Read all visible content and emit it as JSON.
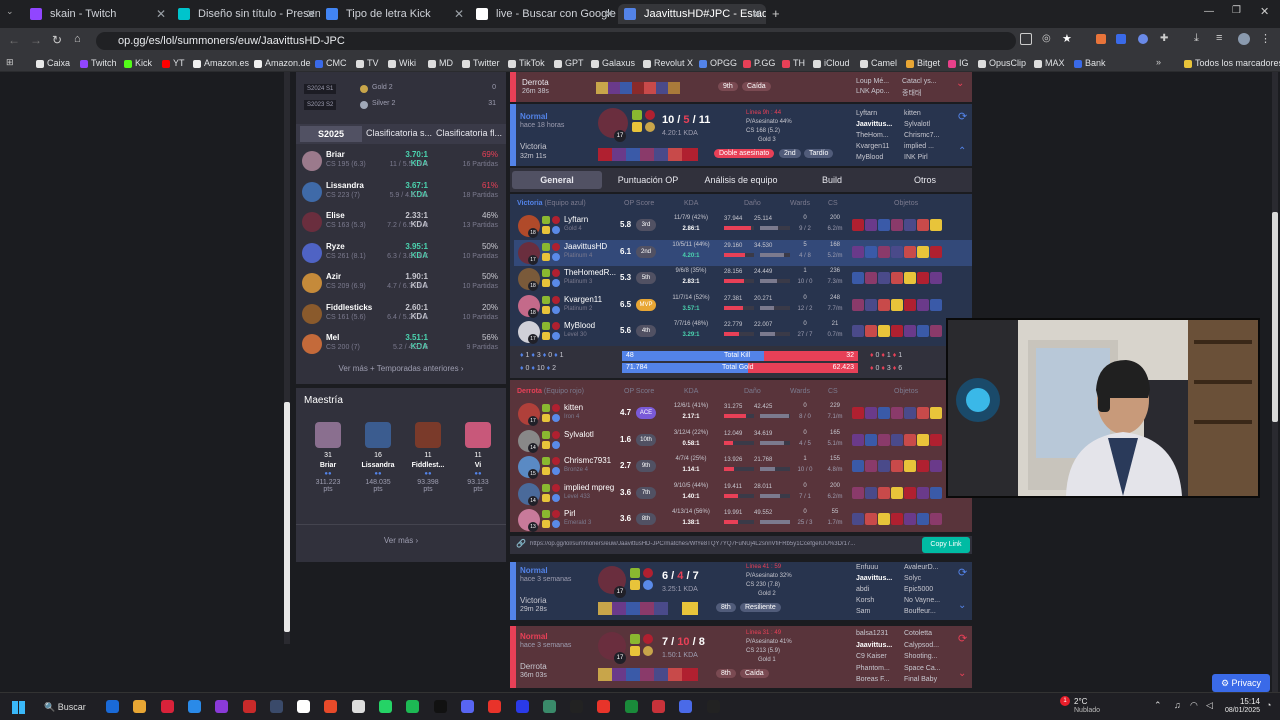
{
  "tabs": [
    {
      "label": "skain - Twitch",
      "color": "#9146ff"
    },
    {
      "label": "Diseño sin título - Presentación",
      "color": "#00c4cc"
    },
    {
      "label": "Tipo de letra Kick",
      "color": "#4285f4"
    },
    {
      "label": "live - Buscar con Google",
      "color": "#ffffff"
    },
    {
      "label": "JaavittusHD#JPC - Estadísticas",
      "color": "#5383e8"
    }
  ],
  "address": "op.gg/es/lol/summoners/euw/JaavittusHD-JPC",
  "bookmarks": [
    "Caixa",
    "Twitch",
    "Kick",
    "YT",
    "Amazon.es",
    "Amazon.de",
    "CMC",
    "TV",
    "Wiki",
    "MD",
    "Twitter",
    "TikTok",
    "GPT",
    "Galaxus",
    "Revolut X",
    "OPGG",
    "P.GG",
    "TH",
    "iCloud",
    "Camel",
    "Bitget",
    "IG",
    "OpusClip",
    "MAX",
    "Bank"
  ],
  "bookmarks_all": "Todos los marcadores",
  "left": {
    "past_seasons": [
      {
        "season": "S2024 S1",
        "rank": "Gold 2",
        "lp": "0"
      },
      {
        "season": "S2023 S2",
        "rank": "Silver 2",
        "lp": "31"
      }
    ],
    "season_tabs": [
      "S2025",
      "Clasificatoria s...",
      "Clasificatoria fl..."
    ],
    "champs": [
      {
        "name": "Briar",
        "cs": "CS 195 (6.3)",
        "kda": "3.70:1 KDA",
        "kda_detail": "11 / 5.5 / 9.4",
        "wr": "69%",
        "games": "16 Partidas",
        "kc": "#4bd5b0",
        "wc": "#e84057",
        "color": "#9b7a8c"
      },
      {
        "name": "Lissandra",
        "cs": "CS 223 (7)",
        "kda": "3.67:1 KDA",
        "kda_detail": "5.9 / 4.6 / 11",
        "wr": "61%",
        "games": "18 Partidas",
        "kc": "#4bd5b0",
        "wc": "#e84057",
        "color": "#3f6aa8"
      },
      {
        "name": "Elise",
        "cs": "CS 163 (5.3)",
        "kda": "2.33:1 KDA",
        "kda_detail": "7.2 / 6.5 / 7.9",
        "wr": "46%",
        "games": "13 Partidas",
        "kc": "#c8c8d0",
        "wc": "#c8c8d0",
        "color": "#6a2e3e"
      },
      {
        "name": "Ryze",
        "cs": "CS 261 (8.1)",
        "kda": "3.95:1 KDA",
        "kda_detail": "6.3 / 3.8 / 8.7",
        "wr": "50%",
        "games": "10 Partidas",
        "kc": "#4bd5b0",
        "wc": "#c8c8d0",
        "color": "#4f63c4"
      },
      {
        "name": "Azir",
        "cs": "CS 209 (6.9)",
        "kda": "1.90:1 KDA",
        "kda_detail": "4.7 / 6.7 / 8.1",
        "wr": "50%",
        "games": "10 Partidas",
        "kc": "#c8c8d0",
        "wc": "#c8c8d0",
        "color": "#c58a3a"
      },
      {
        "name": "Fiddlesticks",
        "cs": "CS 161 (5.6)",
        "kda": "2.60:1 KDA",
        "kda_detail": "6.4 / 5.2 / 7.1",
        "wr": "20%",
        "games": "10 Partidas",
        "kc": "#c8c8d0",
        "wc": "#c8c8d0",
        "color": "#8a5a2c"
      },
      {
        "name": "Mel",
        "cs": "CS 200 (7)",
        "kda": "3.51:1 KDA",
        "kda_detail": "5.2 / 4.3 / 6",
        "wr": "56%",
        "games": "9 Partidas",
        "kc": "#4bd5b0",
        "wc": "#c8c8d0",
        "color": "#c46a3a"
      }
    ],
    "more_seasons": "Ver más + Temporadas anteriores",
    "mastery_title": "Maestría",
    "mastery": [
      {
        "name": "Briar",
        "level": "31",
        "pts": "311.223",
        "unit": "pts",
        "color": "#8a6f8f"
      },
      {
        "name": "Lissandra",
        "level": "16",
        "pts": "148.035",
        "unit": "pts",
        "color": "#3b5c8f"
      },
      {
        "name": "Fiddlest...",
        "level": "11",
        "pts": "93.398",
        "unit": "pts",
        "color": "#7a3a2a"
      },
      {
        "name": "Vi",
        "level": "11",
        "pts": "93.133",
        "unit": "pts",
        "color": "#c8587a"
      }
    ],
    "more": "Ver más"
  },
  "top_match": {
    "result": "Derrota",
    "duration": "26m 38s",
    "tag1": "9th",
    "tag2": "Caída",
    "p1": "Loup Mé...",
    "p2": "LNK Apo...",
    "p3": "Catacl ys...",
    "p4": "종태태"
  },
  "match1": {
    "queue": "Normal",
    "ago": "hace 18 horas",
    "result": "Victoria",
    "duration": "32m 11s",
    "level": "17",
    "k": "10",
    "d": "5",
    "a": "11",
    "kda": "4.20:1 KDA",
    "stats": [
      "Línea 9h : 44",
      "P/Asesinato 44%",
      "CS 168 (5.2)",
      "Gold 3"
    ],
    "badges": [
      "Doble asesinato",
      "2nd",
      "Tardío"
    ],
    "blue_names": [
      "Lyftarn",
      "Jaavittus...",
      "TheHom...",
      "Kvargen11",
      "MyBlood"
    ],
    "red_names": [
      "kitten",
      "Sylvalotl",
      "Chrismc7...",
      "implied ...",
      "INK Pirl"
    ]
  },
  "subtabs": [
    "General",
    "Puntuación OP",
    "Análisis de equipo",
    "Build",
    "Otros"
  ],
  "blue_header": {
    "team": "Victoria",
    "side": "(Equipo azul)",
    "op": "OP Score",
    "kda": "KDA",
    "dmg": "Daño",
    "wards": "Wards",
    "cs": "CS",
    "items": "Objetos"
  },
  "blue": [
    {
      "name": "Lyftarn",
      "rank": "Gold 4",
      "lvl": "18",
      "score": "5.8",
      "pos": "3rd",
      "kda": "11/7/9 (42%)",
      "ratio": "2.86:1",
      "d1": "37.944",
      "d2": "25.114",
      "w": "0",
      "w2": "9 / 2",
      "cs": "200",
      "csm": "6.2/m",
      "f1": 0.9,
      "f2": 0.6,
      "ch": "#b04a2a"
    },
    {
      "name": "JaavittusHD",
      "rank": "Platinum 4",
      "lvl": "17",
      "score": "6.1",
      "pos": "2nd",
      "kda": "10/5/11 (44%)",
      "ratio": "4.20:1",
      "d1": "29.160",
      "d2": "34.530",
      "w": "5",
      "w2": "4 / 8",
      "cs": "168",
      "csm": "5.2/m",
      "f1": 0.7,
      "f2": 0.8,
      "ch": "#6a2e3e",
      "me": true
    },
    {
      "name": "TheHomedR...",
      "rank": "Platinum 3",
      "lvl": "18",
      "score": "5.3",
      "pos": "5th",
      "kda": "9/6/8 (35%)",
      "ratio": "2.83:1",
      "d1": "28.156",
      "d2": "24.449",
      "w": "1",
      "w2": "10 / 0",
      "cs": "236",
      "csm": "7.3/m",
      "f1": 0.65,
      "f2": 0.55,
      "ch": "#7a5a3a"
    },
    {
      "name": "Kvargen11",
      "rank": "Platinum 2",
      "lvl": "18",
      "score": "6.5",
      "pos": "MVP",
      "kda": "11/7/14 (52%)",
      "ratio": "3.57:1",
      "d1": "27.381",
      "d2": "20.271",
      "w": "0",
      "w2": "12 / 2",
      "cs": "248",
      "csm": "7.7/m",
      "f1": 0.62,
      "f2": 0.45,
      "ch": "#c46a8a"
    },
    {
      "name": "MyBlood",
      "rank": "Level 30",
      "lvl": "17",
      "score": "5.6",
      "pos": "4th",
      "kda": "7/7/16 (48%)",
      "ratio": "3.29:1",
      "d1": "22.779",
      "d2": "22.007",
      "w": "0",
      "w2": "27 / 7",
      "cs": "21",
      "csm": "0.7/m",
      "f1": 0.5,
      "f2": 0.5,
      "ch": "#d0d0d8"
    }
  ],
  "totals": {
    "blue_kill": "48",
    "red_kill": "32",
    "kill_label": "Total Kill",
    "blue_gold": "71.784",
    "red_gold": "62.423",
    "gold_label": "Total Gold",
    "blue_obj": [
      "1",
      "3",
      "0",
      "1",
      "0",
      "10",
      "2"
    ],
    "red_obj": [
      "0",
      "1",
      "1",
      "0",
      "3",
      "6"
    ]
  },
  "red_header": {
    "team": "Derrota",
    "side": "(Equipo rojo)"
  },
  "red": [
    {
      "name": "kitten",
      "rank": "Iron 4",
      "lvl": "17",
      "score": "4.7",
      "pos": "ACE",
      "kda": "12/6/1 (41%)",
      "ratio": "2.17:1",
      "d1": "31.275",
      "d2": "42.425",
      "w": "0",
      "w2": "8 / 0",
      "cs": "229",
      "csm": "7.1/m",
      "f1": 0.72,
      "f2": 0.95,
      "ch": "#b0403a"
    },
    {
      "name": "Sylvalotl",
      "rank": "",
      "lvl": "14",
      "score": "1.6",
      "pos": "10th",
      "kda": "3/12/4 (22%)",
      "ratio": "0.58:1",
      "d1": "12.049",
      "d2": "34.619",
      "w": "0",
      "w2": "4 / 5",
      "cs": "165",
      "csm": "5.1/m",
      "f1": 0.3,
      "f2": 0.8,
      "ch": "#888888"
    },
    {
      "name": "Chrismc7931",
      "rank": "Bronze 4",
      "lvl": "15",
      "score": "2.7",
      "pos": "9th",
      "kda": "4/7/4 (25%)",
      "ratio": "1.14:1",
      "d1": "13.926",
      "d2": "21.768",
      "w": "1",
      "w2": "10 / 0",
      "cs": "155",
      "csm": "4.8/m",
      "f1": 0.33,
      "f2": 0.5,
      "ch": "#5a8ac4"
    },
    {
      "name": "implied mpreg",
      "rank": "Level 433",
      "lvl": "14",
      "score": "3.6",
      "pos": "7th",
      "kda": "9/10/5 (44%)",
      "ratio": "1.40:1",
      "d1": "19.411",
      "d2": "28.011",
      "w": "0",
      "w2": "7 / 1",
      "cs": "200",
      "csm": "6.2/m",
      "f1": 0.45,
      "f2": 0.65,
      "ch": "#4a6a9a"
    },
    {
      "name": "Pirl",
      "rank": "Emerald 3",
      "lvl": "13",
      "score": "3.6",
      "pos": "8th",
      "kda": "4/13/14 (56%)",
      "ratio": "1.38:1",
      "d1": "19.991",
      "d2": "49.552",
      "w": "0",
      "w2": "25 / 3",
      "cs": "55",
      "csm": "1.7/m",
      "f1": 0.47,
      "f2": 1.0,
      "ch": "#c87a9a"
    }
  ],
  "copy": {
    "url": "https://op.gg/lol/summoners/euw/JaavittusHD-JPC/matches/WfYe8TQY7YQ7FuNUj4L2snnVfiFRb5y1CcefgeIUU%3D/17...",
    "button": "Copy Link"
  },
  "match2": {
    "queue": "Normal",
    "ago": "hace 3 semanas",
    "result": "Victoria",
    "duration": "29m 28s",
    "level": "17",
    "k": "6",
    "d": "4",
    "a": "7",
    "kda": "3.25:1 KDA",
    "stats": [
      "Línea 41 : 59",
      "P/Asesinato 32%",
      "CS 230 (7.8)",
      "Gold 2"
    ],
    "badges": [
      "8th",
      "Resiliente"
    ],
    "names": [
      "Enfuuu",
      "Jaavittus...",
      "abdi",
      "Korsh",
      "Sam"
    ],
    "names2": [
      "AvaleurD...",
      "Solyc",
      "Epic5000",
      "No Vayne...",
      "Bouffeur..."
    ]
  },
  "match3": {
    "queue": "Normal",
    "ago": "hace 3 semanas",
    "result": "Derrota",
    "duration": "36m 03s",
    "level": "17",
    "k": "7",
    "d": "10",
    "a": "8",
    "kda": "1.50:1 KDA",
    "stats": [
      "Línea 31 : 49",
      "P/Asesinato 41%",
      "CS 213 (5.9)",
      "Gold 1"
    ],
    "badges": [
      "8th",
      "Caída"
    ],
    "names": [
      "balsa1231",
      "Jaavittus...",
      "C9 Kaiser",
      "Phantom...",
      "Boreas F..."
    ],
    "names2": [
      "Cotoletta",
      "Calypsod...",
      "Shooting...",
      "Space Ca...",
      "Final Baby"
    ]
  },
  "privacy": "Privacy",
  "taskbar": {
    "search": "Buscar",
    "temp": "2°C",
    "weather": "Nublado",
    "time": "15:14",
    "date": "08/01/2025",
    "notif": "1"
  },
  "colors": {
    "win_bg": "#28344e",
    "loss_bg": "#59343b",
    "blue": "#5383e8",
    "red": "#e84057",
    "mvp": "#e8a634",
    "ace": "#7a5ad8",
    "teal": "#00bba3"
  }
}
